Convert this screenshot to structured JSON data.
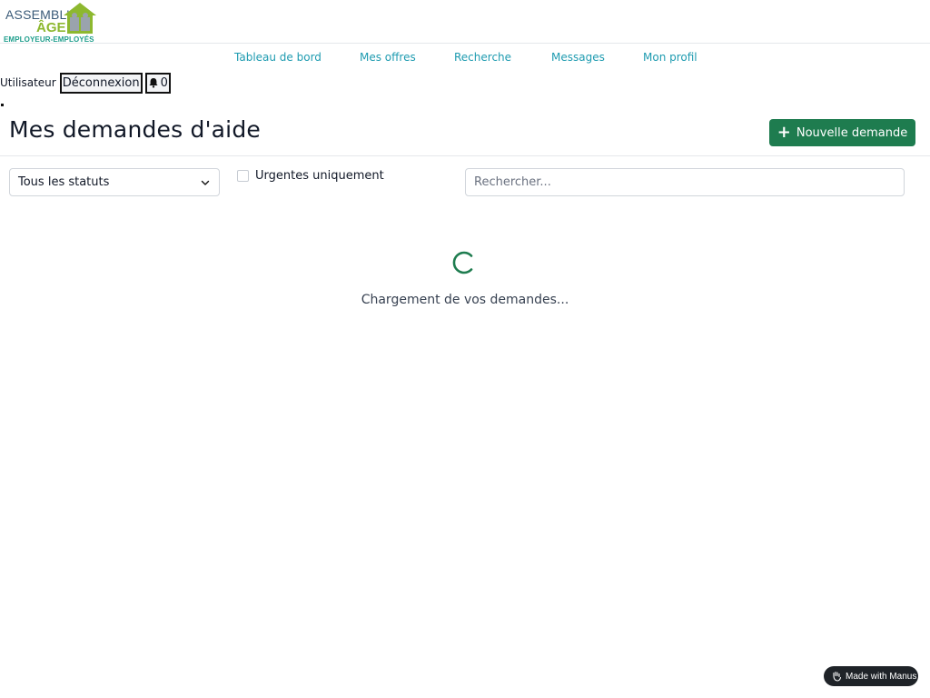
{
  "header": {
    "logo": {
      "line1": "ASSEMBL'",
      "line2": "ÂGE",
      "line3": "EMPLOYEUR-EMPLOYÉS"
    }
  },
  "nav": {
    "items": [
      {
        "label": "Tableau de bord"
      },
      {
        "label": "Mes offres"
      },
      {
        "label": "Recherche"
      },
      {
        "label": "Messages"
      },
      {
        "label": "Mon profil"
      }
    ]
  },
  "user": {
    "name": "Utilisateur",
    "logout_label": "Déconnexion",
    "notifications_count": "0"
  },
  "page": {
    "title": "Mes demandes d'aide",
    "new_button_label": "Nouvelle demande"
  },
  "filters": {
    "status_selected": "Tous les statuts",
    "urgent_label": "Urgentes uniquement",
    "urgent_checked": false,
    "search_placeholder": "Rechercher...",
    "search_value": ""
  },
  "loading": {
    "text": "Chargement de vos demandes..."
  },
  "badge": {
    "label": "Made with Manus"
  },
  "colors": {
    "accent_green": "#1e7c4f",
    "nav_link": "#1e9bb0",
    "logo_green": "#8db82f",
    "logo_teal": "#1e9e8c"
  }
}
